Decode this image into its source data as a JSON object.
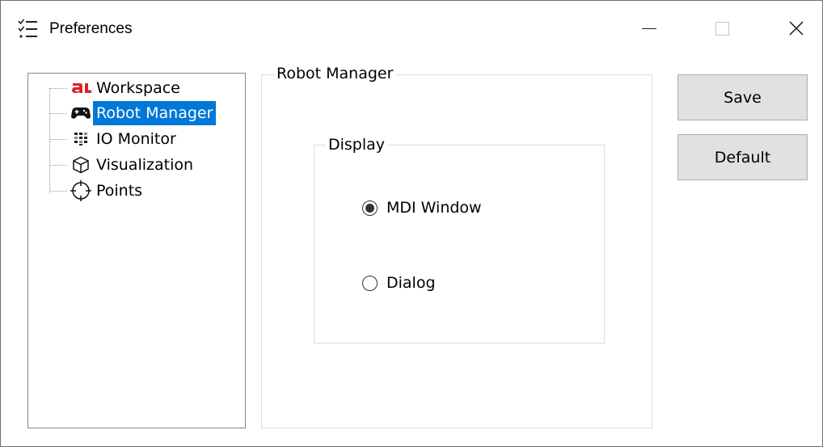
{
  "window": {
    "title": "Preferences",
    "title_icon": "checklist-icon",
    "controls": {
      "minimize_icon": "minimize-icon",
      "maximize_icon": "maximize-icon",
      "close_icon": "close-icon"
    }
  },
  "tree": {
    "selected_index": 1,
    "items": [
      {
        "label": "Workspace",
        "icon": "workspace-logo-icon"
      },
      {
        "label": "Robot Manager",
        "icon": "gamepad-icon"
      },
      {
        "label": "IO Monitor",
        "icon": "io-grid-icon"
      },
      {
        "label": "Visualization",
        "icon": "cube-icon"
      },
      {
        "label": "Points",
        "icon": "crosshair-icon"
      }
    ]
  },
  "robot_manager": {
    "group_title": "Robot Manager",
    "display": {
      "group_title": "Display",
      "options": [
        {
          "label": "MDI Window",
          "checked": true
        },
        {
          "label": "Dialog",
          "checked": false
        }
      ]
    }
  },
  "buttons": {
    "save_label": "Save",
    "default_label": "Default"
  },
  "colors": {
    "selection": "#0078d7",
    "button_face": "#e1e1e1",
    "workspace_icon": "#d9232a"
  }
}
